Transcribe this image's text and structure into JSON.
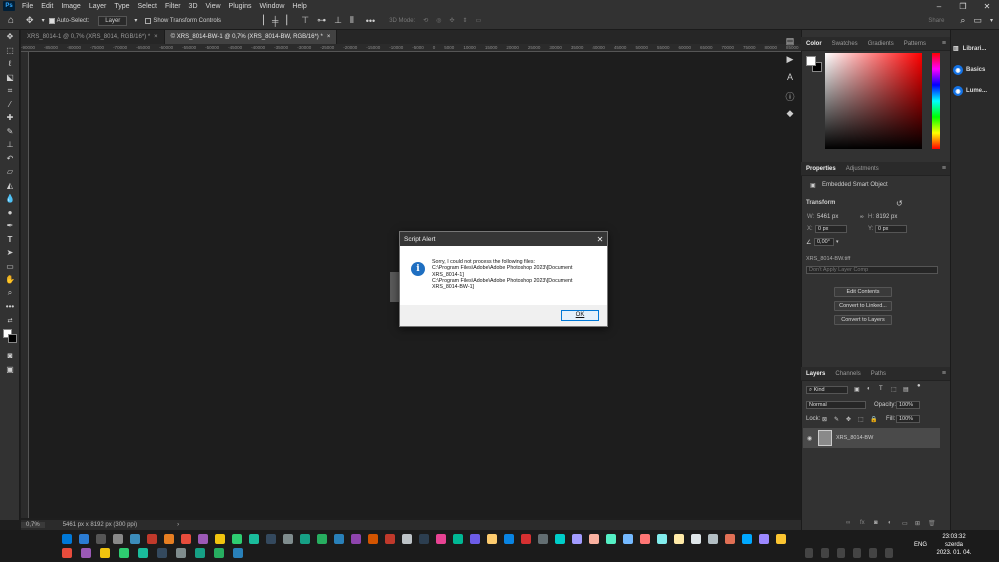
{
  "menubar": {
    "logo": "Ps",
    "items": [
      "File",
      "Edit",
      "Image",
      "Layer",
      "Type",
      "Select",
      "Filter",
      "3D",
      "View",
      "Plugins",
      "Window",
      "Help"
    ]
  },
  "options": {
    "auto_select_label": "Auto-Select:",
    "layer_dropdown": "Layer",
    "show_transform_label": "Show Transform Controls",
    "mode_3d": "3D Mode:",
    "share": "Share"
  },
  "tabs": [
    {
      "label": "XRS_8014-1 @ 0,7% (XRS_8014, RGB/16*) *"
    },
    {
      "label": "© XRS_8014-BW-1 @ 0,7% (XRS_8014-BW, RGB/16*) *"
    }
  ],
  "ruler_ticks": [
    "-90000",
    "-85000",
    "-80000",
    "-75000",
    "-70000",
    "-65000",
    "-60000",
    "-55000",
    "-50000",
    "-45000",
    "-40000",
    "-35000",
    "-30000",
    "-25000",
    "-20000",
    "-15000",
    "-10000",
    "-5000",
    "0",
    "5000",
    "10000",
    "15000",
    "20000",
    "25000",
    "30000",
    "35000",
    "40000",
    "45000",
    "50000",
    "55000",
    "60000",
    "65000",
    "70000",
    "75000",
    "80000",
    "85000",
    "90000",
    "95000"
  ],
  "status": {
    "zoom": "0,7%",
    "doc_size": "5461 px x 8192 px (300 ppi)"
  },
  "color_panel": {
    "tabs": [
      "Color",
      "Swatches",
      "Gradients",
      "Patterns"
    ]
  },
  "properties": {
    "tabs": [
      "Properties",
      "Adjustments"
    ],
    "type": "Embedded Smart Object",
    "transform_label": "Transform",
    "w_label": "W:",
    "w_value": "5461 px",
    "h_label": "H:",
    "h_value": "8192 px",
    "x_label": "X:",
    "x_value": "0 px",
    "y_label": "Y:",
    "y_value": "0 px",
    "angle_value": "0,00°",
    "file_name": "XRS_8014-BW.tiff",
    "layer_comp": "Don't Apply Layer Comp",
    "btn_edit": "Edit Contents",
    "btn_linked": "Convert to Linked...",
    "btn_layers": "Convert to Layers"
  },
  "layers": {
    "tabs": [
      "Layers",
      "Channels",
      "Paths"
    ],
    "kind": "Kind",
    "blend_mode": "Normal",
    "opacity_label": "Opacity:",
    "opacity_value": "100%",
    "lock_label": "Lock:",
    "fill_label": "Fill:",
    "fill_value": "100%",
    "layer_name": "XRS_8014-BW"
  },
  "far_right": {
    "libraries": "Librari...",
    "basics": "Basics",
    "lumen": "Lume..."
  },
  "dialog": {
    "title": "Script Alert",
    "message": "Sorry, I could not process the following files:\nC:\\Program Files\\Adobe\\Adobe Photoshop 2023\\[Document\nXRS_8014-1]\nC:\\Program Files\\Adobe\\Adobe Photoshop 2023\\[Document\nXRS_8014-BW-1]",
    "ok_label": "OK"
  },
  "taskbar": {
    "lang": "ENG",
    "time": "23:03:32",
    "day": "szerda",
    "date": "2023. 01. 04."
  }
}
